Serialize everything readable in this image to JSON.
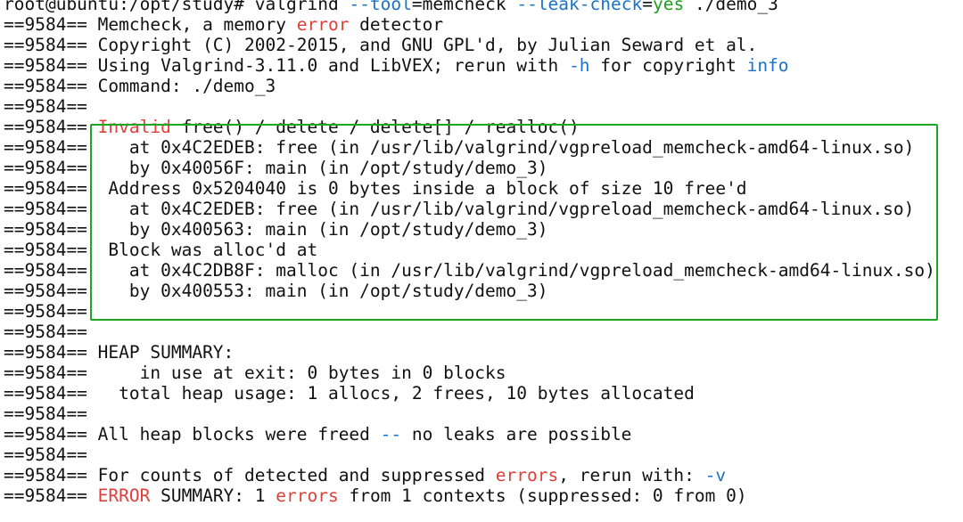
{
  "prompt": {
    "user_host_path": "root@ubuntu:/opt/study#",
    "cmd": "valgrind",
    "opt_tool": "--tool",
    "eq1": "=",
    "tool_value": "memcheck",
    "opt_leak": "--leak-check",
    "eq2": "=",
    "leak_value": "yes",
    "target": "./demo_3"
  },
  "pid_prefix": "==9584==",
  "header": {
    "l1_a": "Memcheck, a memory ",
    "l1_error": "error",
    "l1_b": " detector",
    "l2": "Copyright (C) 2002-2015, and GNU GPL'd, by Julian Seward et al.",
    "l3_a": "Using Valgrind-3.11.0 and LibVEX; rerun with ",
    "l3_h": "-h",
    "l3_b": " for copyright ",
    "l3_info": "info",
    "l4": "Command: ./demo_3"
  },
  "invalid_block": {
    "title_invalid": "Invalid",
    "title_rest": " free() / delete / delete[] / realloc()",
    "lines": [
      "   at 0x4C2EDEB: free (in /usr/lib/valgrind/vgpreload_memcheck-amd64-linux.so)",
      "   by 0x40056F: main (in /opt/study/demo_3)",
      " Address 0x5204040 is 0 bytes inside a block of size 10 free'd",
      "   at 0x4C2EDEB: free (in /usr/lib/valgrind/vgpreload_memcheck-amd64-linux.so)",
      "   by 0x400563: main (in /opt/study/demo_3)",
      " Block was alloc'd at",
      "   at 0x4C2DB8F: malloc (in /usr/lib/valgrind/vgpreload_memcheck-amd64-linux.so)",
      "   by 0x400553: main (in /opt/study/demo_3)"
    ]
  },
  "heap": {
    "title": "HEAP SUMMARY:",
    "in_use": "    in use at exit: 0 bytes in 0 blocks",
    "total": "  total heap usage: 1 allocs, 2 frees, 10 bytes allocated",
    "freed_a": "All heap blocks were freed ",
    "freed_dash": "--",
    "freed_b": " no leaks are possible"
  },
  "footer": {
    "counts_a": "For counts of detected and suppressed ",
    "counts_errors": "errors",
    "counts_b": ", rerun with: ",
    "counts_v": "-v",
    "summary_error": "ERROR",
    "summary_a": " SUMMARY: 1 ",
    "summary_errors": "errors",
    "summary_b": " from 1 contexts (suppressed: 0 from 0)"
  },
  "colors": {
    "text": "#111111",
    "keyword_red": "#e0403a",
    "option_blue": "#1a73c8",
    "value_green": "#1e9e1e",
    "box_green": "#1fa51f"
  }
}
